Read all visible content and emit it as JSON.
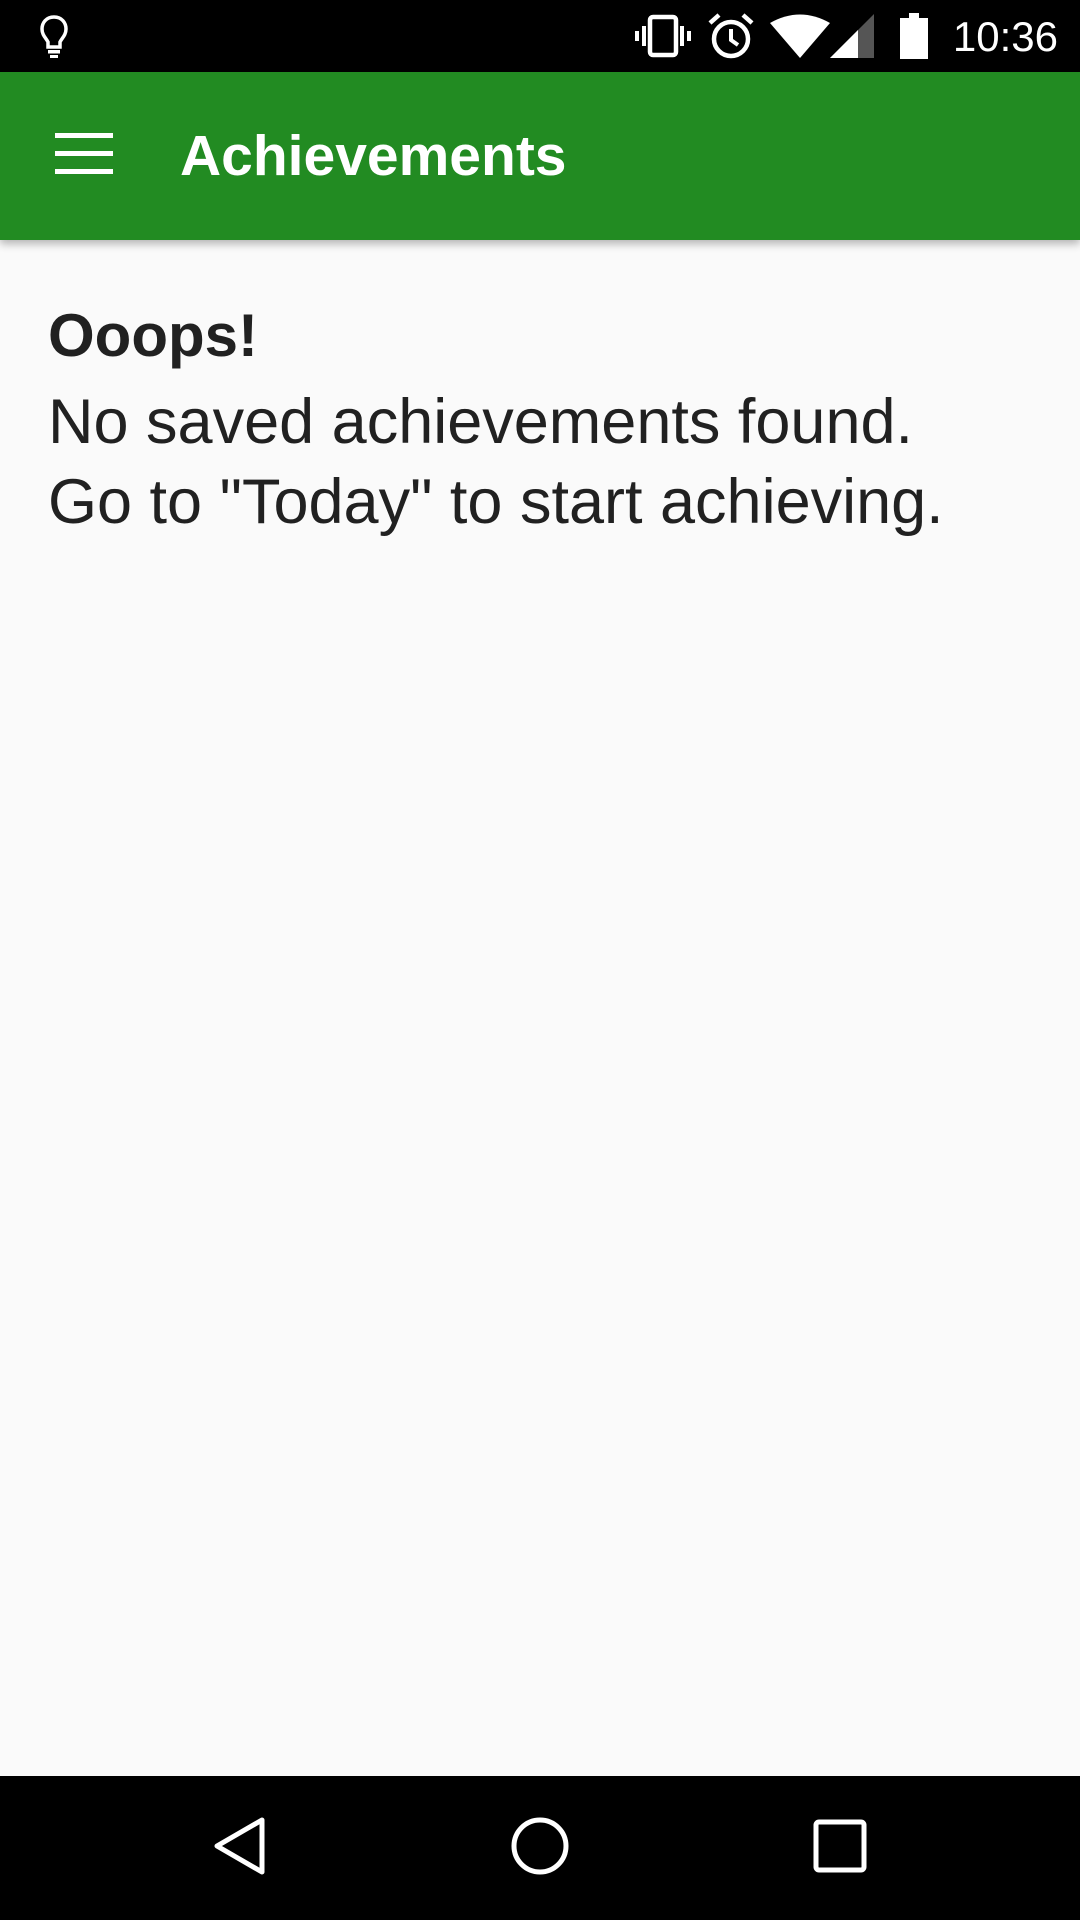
{
  "status_bar": {
    "time": "10:36",
    "icons": [
      "lightbulb-icon",
      "vibrate-icon",
      "alarm-icon",
      "wifi-icon",
      "signal-icon",
      "battery-icon"
    ]
  },
  "toolbar": {
    "title": "Achievements",
    "menu_icon": "hamburger-menu-icon",
    "color": "#228B22"
  },
  "empty_state": {
    "title": "Ooops!",
    "message_line1": "No saved achievements found.",
    "message_line2": "Go to \"Today\" to start achieving."
  },
  "nav_bar": {
    "buttons": [
      "back-icon",
      "home-icon",
      "recents-icon"
    ]
  }
}
